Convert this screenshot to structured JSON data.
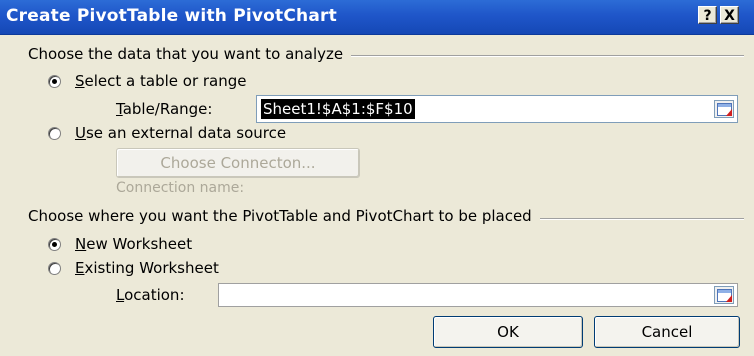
{
  "window": {
    "title": "Create PivotTable with PivotChart",
    "help_button": "?",
    "close_button": "X"
  },
  "data_section": {
    "heading": "Choose the data that you want to analyze",
    "option_table": {
      "mnemonic": "S",
      "rest": "elect a table or range",
      "checked": true
    },
    "table_range": {
      "mnemonic": "T",
      "rest": "able/Range:",
      "value": "Sheet1!$A$1:$F$10"
    },
    "option_external": {
      "mnemonic": "U",
      "rest": "se an external data source",
      "checked": false
    },
    "choose_connection_button": "Choose Connecton...",
    "connection_name_label": "Connection name:"
  },
  "placement_section": {
    "heading": "Choose where you want the PivotTable and PivotChart to be placed",
    "option_new": {
      "mnemonic": "N",
      "rest": "ew Worksheet",
      "checked": true
    },
    "option_existing": {
      "mnemonic": "E",
      "rest": "xisting Worksheet",
      "checked": false
    },
    "location": {
      "mnemonic": "L",
      "rest": "ocation:",
      "value": ""
    }
  },
  "buttons": {
    "ok": "OK",
    "cancel": "Cancel"
  },
  "colors": {
    "title_bar": "#1F56C9",
    "dialog_bg": "#ECE9D8"
  }
}
